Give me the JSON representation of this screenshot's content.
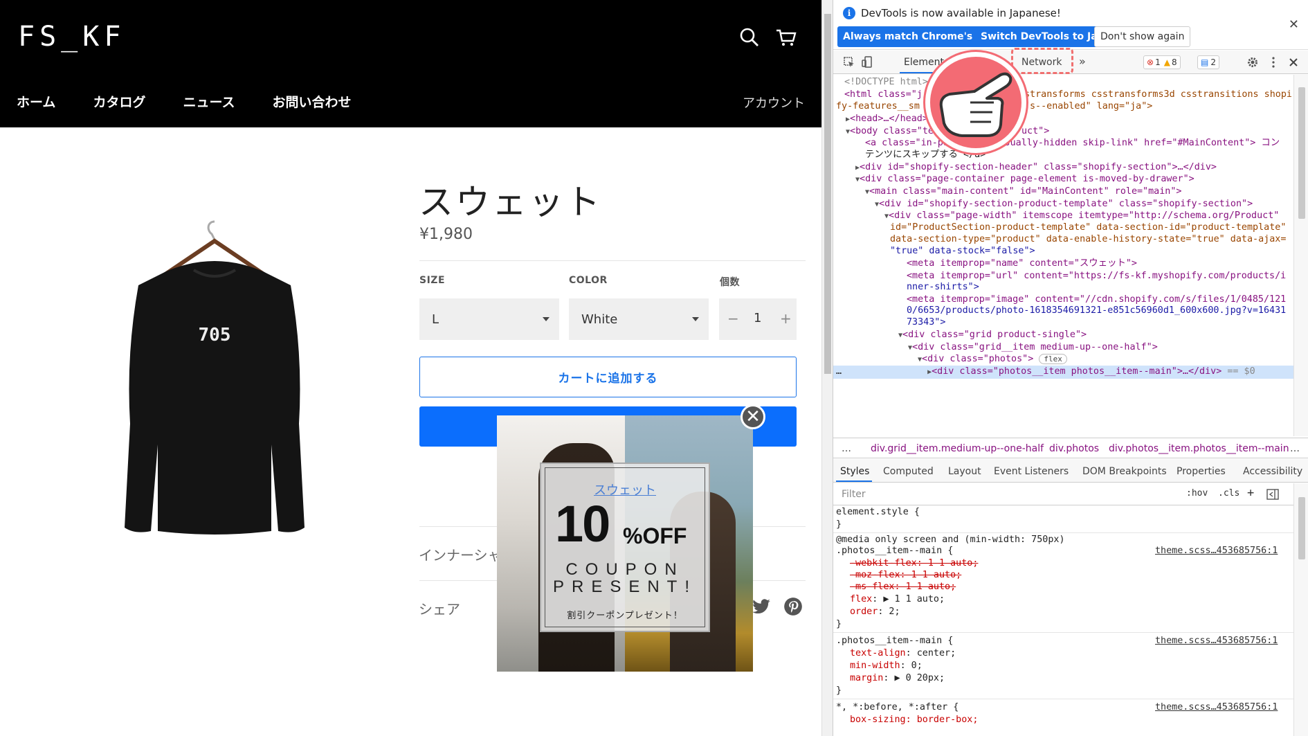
{
  "site": {
    "logo": "FS_KF",
    "nav": [
      "ホーム",
      "カタログ",
      "ニュース",
      "お問い合わせ"
    ],
    "account": "アカウント",
    "product": {
      "title": "スウェット",
      "price": "¥1,980",
      "shirt_print": "705",
      "size_label": "SIZE",
      "size_value": "L",
      "color_label": "COLOR",
      "color_value": "White",
      "qty_label": "個数",
      "qty_minus": "−",
      "qty_value": "1",
      "qty_plus": "+",
      "add_to_cart": "カートに追加する",
      "description_partial": "インナーシャ",
      "share_label": "シェア"
    },
    "popup": {
      "product_link": "スウェット",
      "big_number": "10",
      "off": "%OFF",
      "line1": "COUPON",
      "line2": "PRESENT!",
      "jp_text": "割引クーポンプレゼント！",
      "close": "✕"
    }
  },
  "devtools": {
    "infobar": {
      "message": "DevTools is now available in Japanese!",
      "btn_match": "Always match Chrome's language",
      "btn_switch": "Switch DevTools to Japanese",
      "btn_dont_show": "Don't show again",
      "close": "✕"
    },
    "tabs": {
      "elements": "Elements",
      "network": "Network",
      "more": "»",
      "errors": "1",
      "warnings": "8",
      "messages": "2"
    },
    "code_lines": {
      "l1": "<!DOCTYPE html>",
      "l2a": "<html class=\"j",
      "l2b": "stransforms csstransforms3d csstransitions shopi",
      "l3a": "fy-features__sm",
      "l3b": "s--enabled\" lang=\"ja\">",
      "l4": "<head>…</head>",
      "l5a": "<body class=\"te",
      "l5b": "uct\">",
      "l6": "<a class=\"in-page-link visually-hidden skip-link\" href=\"#MainContent\"> コン",
      "l6b": "テンツにスキップする </a>",
      "l7": "<div id=\"shopify-section-header\" class=\"shopify-section\">…</div>",
      "l8": "<div class=\"page-container page-element is-moved-by-drawer\">",
      "l9": "<main class=\"main-content\" id=\"MainContent\" role=\"main\">",
      "l10": "<div id=\"shopify-section-product-template\" class=\"shopify-section\">",
      "l11": "<div class=\"page-width\" itemscope itemtype=\"http://schema.org/Product\"",
      "l11b": "id=\"ProductSection-product-template\" data-section-id=\"product-template\"",
      "l11c": "data-section-type=\"product\" data-enable-history-state=\"true\" data-ajax=",
      "l11d": "\"true\" data-stock=\"false\">",
      "l12": "<meta itemprop=\"name\" content=\"スウェット\">",
      "l13": "<meta itemprop=\"url\" content=\"https://fs-kf.myshopify.com/products/i",
      "l13b": "nner-shirts\">",
      "l14": "<meta itemprop=\"image\" content=\"//cdn.shopify.com/s/files/1/0485/121",
      "l14b": "0/6653/products/photo-1618354691321-e851c56960d1_600x600.jpg?v=16431",
      "l14c": "73343\">",
      "l15": "<div class=\"grid product-single\">",
      "l16": "<div class=\"grid__item medium-up--one-half\">",
      "l17": "<div class=\"photos\">",
      "l17flex": "flex",
      "l18": "<div class=\"photos__item photos__item--main\">…</div>",
      "l18sel": "== $0",
      "ellipsis": "…"
    },
    "breadcrumbs": [
      "…",
      "div.grid__item.medium-up--one-half",
      "div.photos",
      "div.photos__item.photos__item--main",
      "…"
    ],
    "subtabs": [
      "Styles",
      "Computed",
      "Layout",
      "Event Listeners",
      "DOM Breakpoints",
      "Properties",
      "Accessibility"
    ],
    "filter": {
      "placeholder": "Filter",
      "hov": ":hov",
      "cls": ".cls",
      "plus": "+"
    },
    "styles": {
      "s1": "element.style {",
      "s1e": "}",
      "s2": "@media only screen and (min-width: 750px)",
      "s3": ".photos__item--main {",
      "src": "theme.scss…453685756:1",
      "s4": "-webkit-flex: 1 1 auto;",
      "s5": "-moz-flex: 1 1 auto;",
      "s6": "-ms-flex: 1 1 auto;",
      "s7p": "flex",
      "s7v": ": ▶ 1 1 auto;",
      "s8p": "order",
      "s8v": ": 2;",
      "s9": "}",
      "s10": ".photos__item--main {",
      "s11p": "text-align",
      "s11v": ": center;",
      "s12p": "min-width",
      "s12v": ": 0;",
      "s13p": "margin",
      "s13v": ": ▶ 0 20px;",
      "s14": "}",
      "s15": "*, *:before, *:after {",
      "s16": "box-sizing: border-box;"
    }
  }
}
